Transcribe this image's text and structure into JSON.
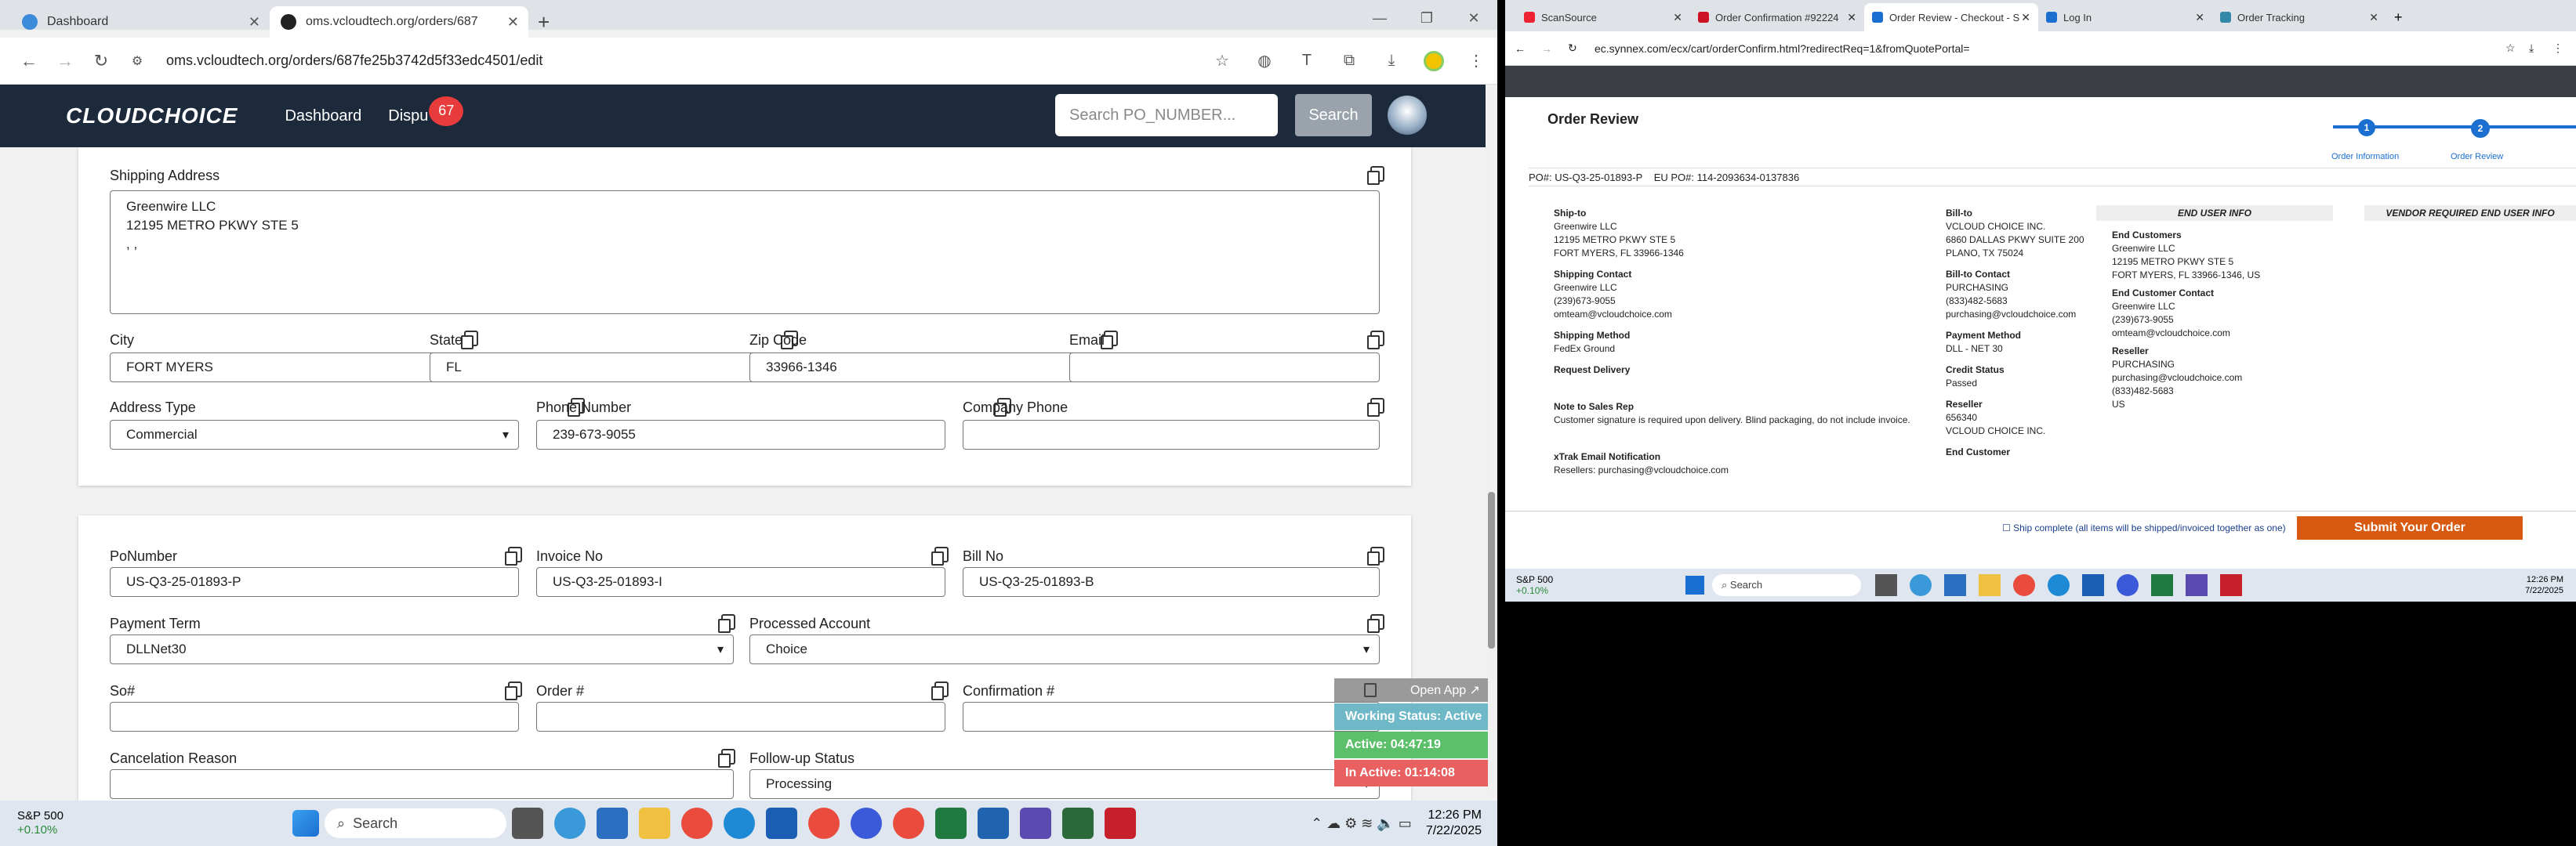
{
  "left_browser": {
    "tabs": [
      {
        "label": "Dashboard",
        "active": false
      },
      {
        "label": "oms.vcloudtech.org/orders/687",
        "active": true
      }
    ],
    "url": "oms.vcloudtech.org/orders/687fe25b3742d5f33edc4501/edit",
    "app": {
      "logo": "CLOUDCHOICE",
      "nav": [
        "Dashboard",
        "Dispu"
      ],
      "badge_count": "67",
      "search_placeholder": "Search PO_NUMBER...",
      "search_button": "Search"
    },
    "shipping": {
      "address_label": "Shipping Address",
      "address_lines": [
        "Greenwire LLC",
        "12195 METRO PKWY STE 5",
        ", ,"
      ],
      "city_label": "City",
      "city": "FORT MYERS",
      "state_label": "State",
      "state": "FL",
      "zip_label": "Zip Code",
      "zip": "33966-1346",
      "email_label": "Email",
      "email": "",
      "address_type_label": "Address Type",
      "address_type": "Commercial",
      "phone_label": "Phone Number",
      "phone": "239-673-9055",
      "company_phone_label": "Company Phone",
      "company_phone": ""
    },
    "order": {
      "po_label": "PoNumber",
      "po": "US-Q3-25-01893-P",
      "invoice_label": "Invoice No",
      "invoice": "US-Q3-25-01893-I",
      "bill_label": "Bill No",
      "bill": "US-Q3-25-01893-B",
      "payment_term_label": "Payment Term",
      "payment_term": "DLLNet30",
      "processed_label": "Processed Account",
      "processed": "Choice",
      "so_label": "So#",
      "so": "",
      "order_no_label": "Order #",
      "order_no": "",
      "confirm_label": "Confirmation #",
      "confirm": "",
      "cancel_label": "Cancelation Reason",
      "followup_label": "Follow-up Status",
      "followup": "Processing"
    },
    "floating": {
      "open_app": "Open App ↗",
      "working": "Working Status: Active",
      "active": "Active: 04:47:19",
      "inactive": "In Active: 01:14:08"
    },
    "taskbar": {
      "stock": "S&P 500",
      "stock_change": "+0.10%",
      "search": "Search",
      "time": "12:26 PM",
      "date": "7/22/2025"
    }
  },
  "right_browser": {
    "tabs": [
      {
        "label": "ScanSource"
      },
      {
        "label": "Order Confirmation #92224"
      },
      {
        "label": "Order Review - Checkout - S"
      },
      {
        "label": "Log In"
      },
      {
        "label": "Order Tracking"
      }
    ],
    "url": "ec.synnex.com/ecx/cart/orderConfirm.html?redirectReq=1&fromQuotePortal=",
    "title": "Order Review",
    "steps": [
      "Order Information",
      "Order Review"
    ],
    "po_line": "PO#: US-Q3-25-01893-P",
    "eu_po_line": "EU PO#: 114-2093634-0137836",
    "ship_to_title": "Ship-to",
    "ship_to": [
      "Greenwire LLC",
      "12195 METRO PKWY STE 5",
      "FORT MYERS, FL 33966-1346"
    ],
    "shipping_contact_title": "Shipping Contact",
    "shipping_contact": [
      "Greenwire LLC",
      "(239)673-9055",
      "omteam@vcloudchoice.com"
    ],
    "shipping_method_title": "Shipping Method",
    "shipping_method": "FedEx Ground",
    "request_delivery": "Request Delivery",
    "note_title": "Note to Sales Rep",
    "note": "Customer signature is required upon delivery. Blind packaging, do not include invoice.",
    "xtrak_title": "xTrak Email Notification",
    "xtrak": "Resellers: purchasing@vcloudchoice.com",
    "bill_to_title": "Bill-to",
    "bill_to": [
      "VCLOUD CHOICE INC.",
      "6860 DALLAS PKWY SUITE 200",
      "PLANO, TX 75024"
    ],
    "bill_contact_title": "Bill-to Contact",
    "bill_contact": [
      "PURCHASING",
      "(833)482-5683",
      "purchasing@vcloudchoice.com"
    ],
    "payment_title": "Payment Method",
    "payment": "DLL - NET 30",
    "credit_title": "Credit Status",
    "credit": "Passed",
    "reseller_title": "Reseller",
    "reseller": [
      "656340",
      "VCLOUD CHOICE INC."
    ],
    "end_customer_title": "End Customer",
    "end_user_info": "END USER INFO",
    "vendor_info": "VENDOR REQUIRED END USER INFO",
    "end_customers_title": "End Customers",
    "end_customers": [
      "Greenwire LLC",
      "12195 METRO PKWY STE 5",
      "FORT MYERS, FL  33966-1346, US"
    ],
    "end_contact_title": "End Customer Contact",
    "end_contact": [
      "Greenwire LLC",
      "(239)673-9055",
      "omteam@vcloudchoice.com"
    ],
    "reseller2_title": "Reseller",
    "reseller2": [
      "PURCHASING",
      "purchasing@vcloudchoice.com",
      "(833)482-5683",
      "US"
    ],
    "ship_complete": "Ship complete (all items will be shipped/invoiced together as one)",
    "submit": "Submit Your Order",
    "taskbar": {
      "stock": "S&P 500",
      "stock_change": "+0.10%",
      "search": "Search",
      "time": "12:26 PM",
      "date": "7/22/2025"
    }
  }
}
